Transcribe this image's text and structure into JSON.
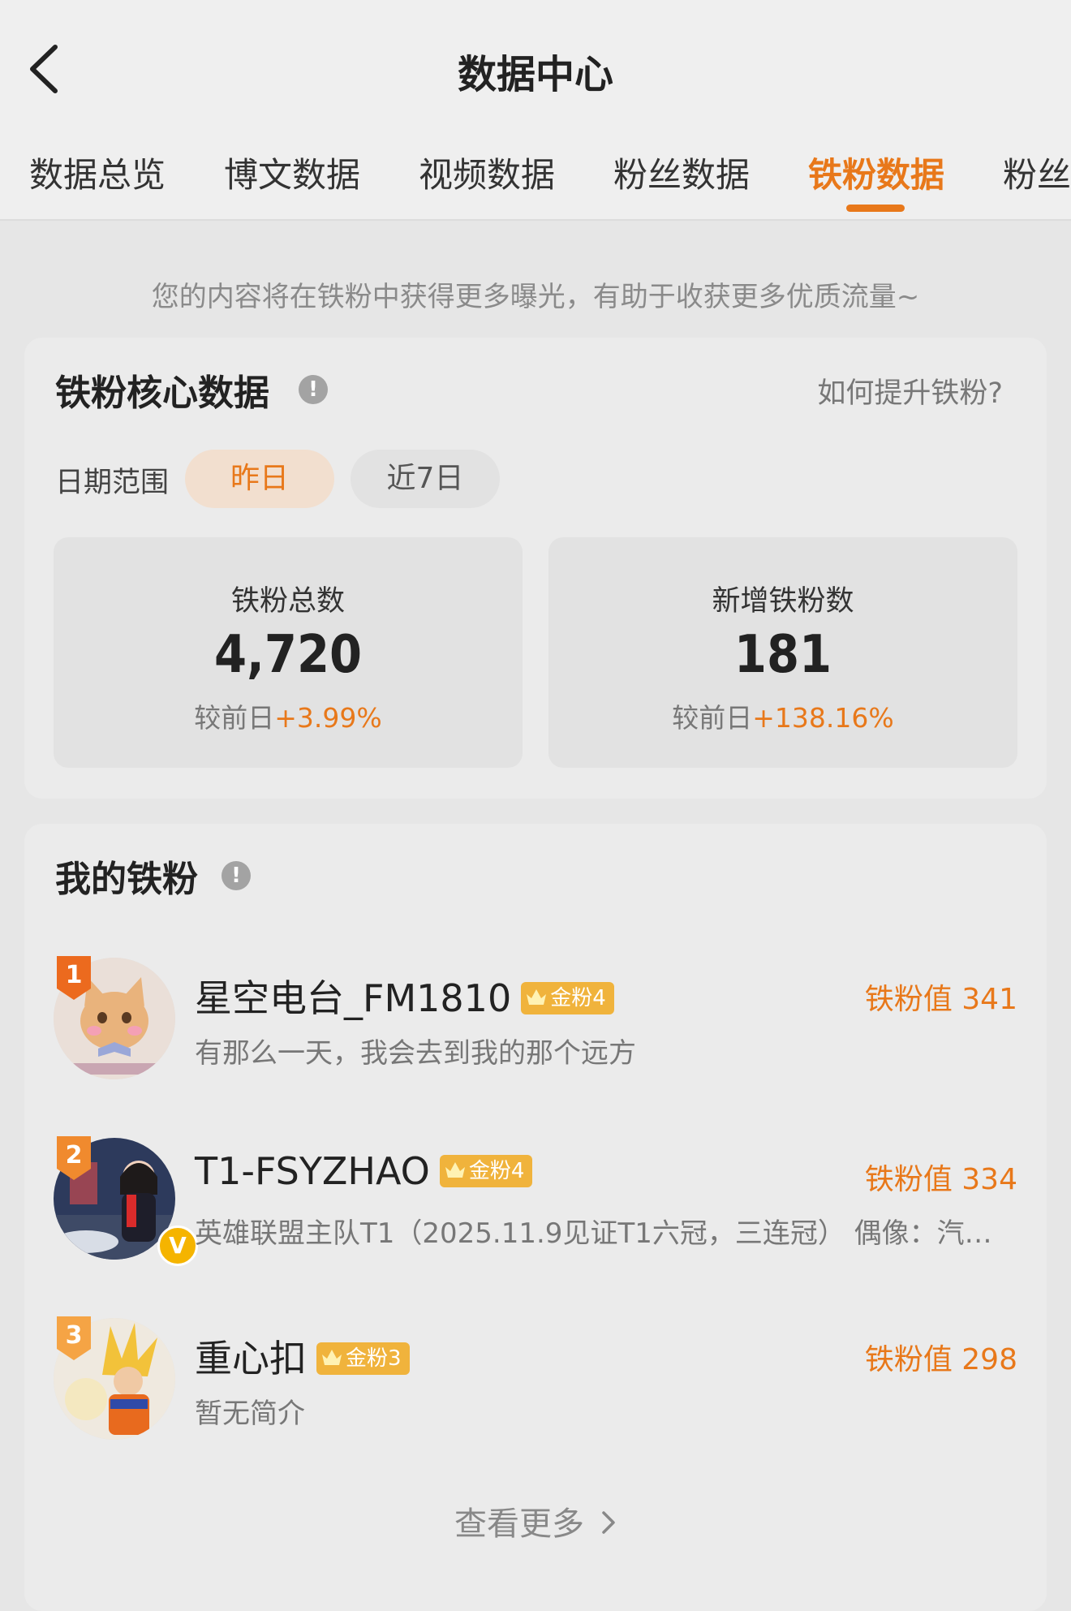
{
  "header": {
    "title": "数据中心",
    "tabs": [
      {
        "label": "数据总览",
        "active": false
      },
      {
        "label": "博文数据",
        "active": false
      },
      {
        "label": "视频数据",
        "active": false
      },
      {
        "label": "粉丝数据",
        "active": false
      },
      {
        "label": "铁粉数据",
        "active": true
      },
      {
        "label": "粉丝",
        "active": false
      }
    ]
  },
  "tip": "您的内容将在铁粉中获得更多曝光，有助于收获更多优质流量~",
  "core": {
    "title": "铁粉核心数据",
    "info_icon": "info-icon",
    "help_link": "如何提升铁粉?",
    "date_label": "日期范围",
    "date_options": [
      {
        "label": "昨日",
        "active": true
      },
      {
        "label": "近7日",
        "active": false
      }
    ],
    "stats": [
      {
        "label": "铁粉总数",
        "value": "4,720",
        "compare_label": "较前日",
        "delta": "+3.99%"
      },
      {
        "label": "新增铁粉数",
        "value": "181",
        "compare_label": "较前日",
        "delta": "+138.16%"
      }
    ]
  },
  "fans": {
    "title": "我的铁粉",
    "items": [
      {
        "rank": "1",
        "name": "星空电台_FM1810",
        "level": "金粉4",
        "score": "铁粉值 341",
        "desc": "有那么一天，我会去到我的那个远方",
        "verified": false
      },
      {
        "rank": "2",
        "name": "T1-FSYZHAO",
        "level": "金粉4",
        "score": "铁粉值 334",
        "desc": "英雄联盟主队T1（2025.11.9见证T1六冠，三连冠） 偶像：汽…",
        "verified": true
      },
      {
        "rank": "3",
        "name": "重心扣",
        "level": "金粉3",
        "score": "铁粉值 298",
        "desc": "暂无简介",
        "verified": false
      }
    ],
    "view_more": "查看更多"
  },
  "colors": {
    "accent": "#e8781a",
    "badge_gold": "#f0b33c",
    "background": "#e6e6e6"
  }
}
